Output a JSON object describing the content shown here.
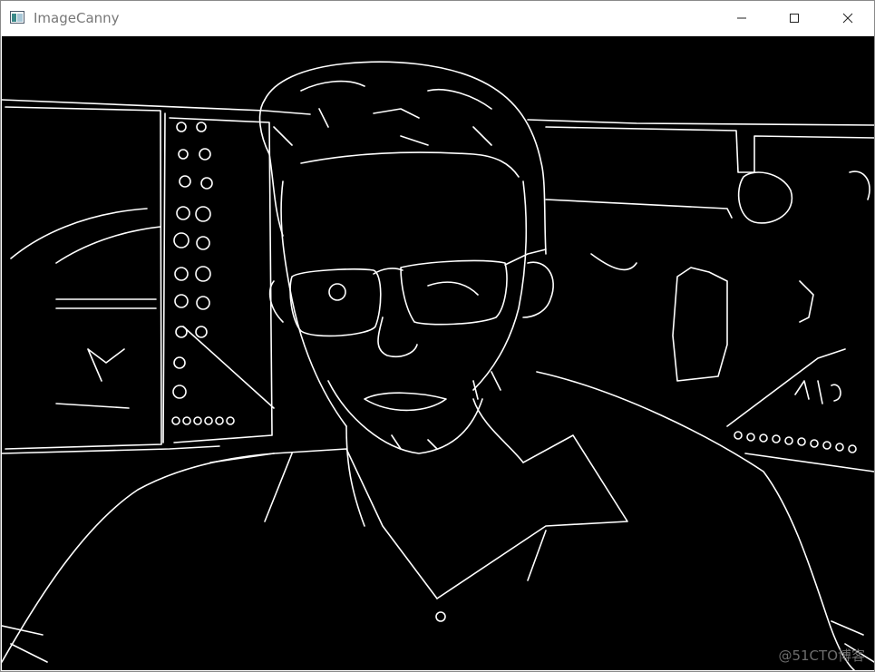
{
  "window": {
    "title": "ImageCanny",
    "icon": "opencv-window-icon"
  },
  "controls": {
    "minimize": "minimize-icon",
    "maximize": "maximize-icon",
    "close": "close-icon"
  },
  "image": {
    "description": "canny-edges",
    "watermark": "@51CTO博客"
  },
  "colors": {
    "canvas_bg": "#000000",
    "edge": "#ffffff",
    "title_text": "#777777"
  }
}
